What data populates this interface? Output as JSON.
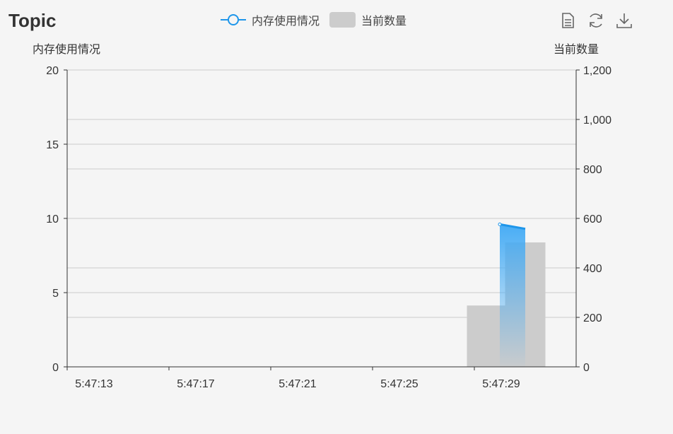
{
  "header": {
    "title": "Topic"
  },
  "legend": {
    "line_label": "内存使用情况",
    "bar_label": "当前数量"
  },
  "toolbox": {
    "icons": [
      "data-view-icon",
      "refresh-icon",
      "download-icon"
    ]
  },
  "colors": {
    "line": "#1e96ea",
    "bar": "#cccccc",
    "axis": "#333333",
    "grid": "#cccccc"
  },
  "chart_data": {
    "type": "bar",
    "title": "Topic",
    "y_left_label": "内存使用情况",
    "y_right_label": "当前数量",
    "y_left_ticks": [
      "0",
      "5",
      "10",
      "15",
      "20"
    ],
    "y_right_ticks": [
      "0",
      "200",
      "400",
      "600",
      "800",
      "1,000",
      "1,200"
    ],
    "x_ticks": [
      "5:47:13",
      "5:47:17",
      "5:47:21",
      "5:47:25",
      "5:47:29"
    ],
    "y_left_range": [
      0,
      20
    ],
    "y_right_range": [
      0,
      1200
    ],
    "series": [
      {
        "name": "内存使用情况",
        "type": "line-area",
        "axis": "left",
        "x": [
          "5:47:30",
          "5:47:31"
        ],
        "values": [
          9.6,
          9.3
        ]
      },
      {
        "name": "当前数量",
        "type": "bar",
        "axis": "right",
        "x": [
          "5:47:29.5",
          "5:47:31"
        ],
        "values": [
          248,
          503
        ]
      }
    ],
    "grid": true,
    "legend_position": "top-center"
  }
}
